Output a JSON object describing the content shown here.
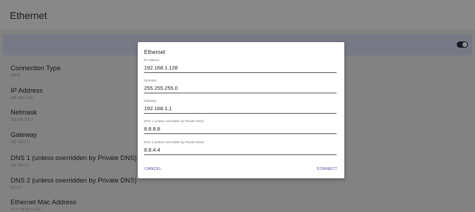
{
  "appbar": {
    "title": "Ethernet"
  },
  "settings": [
    {
      "title": "Connection Type",
      "subtitle": "DHCP"
    },
    {
      "title": "IP Address",
      "subtitle": "192.168.1.116"
    },
    {
      "title": "Netmask",
      "subtitle": "255.255.255.0"
    },
    {
      "title": "Gateway",
      "subtitle": "192.168.1.1"
    },
    {
      "title": "DNS 1 (unless overridden by Private DNS)",
      "subtitle": "192.168.1.1"
    },
    {
      "title": "DNS 2 (unless overridden by Private DNS)",
      "subtitle": "0.0.0.0"
    },
    {
      "title": "Ethernet Mac Address",
      "subtitle": "74:37:38:00:C1:DD"
    }
  ],
  "dialog": {
    "title": "Ethernet",
    "fields": [
      {
        "label": "IP Address",
        "value": "192.168.1.128"
      },
      {
        "label": "Netmask",
        "value": "255.255.255.0"
      },
      {
        "label": "Gateway",
        "value": "192.168.1.1"
      },
      {
        "label": "DNS 1 (unless overridden by Private DNS)",
        "value": "8.8.8.8"
      },
      {
        "label": "DNS 2 (unless overridden by Private DNS)",
        "value": "8.8.4.4"
      }
    ],
    "cancel_label": "CANCEL",
    "connect_label": "CONNECT"
  },
  "colors": {
    "accent": "#3a3f8f",
    "toggle_row": "#d9def5"
  },
  "toggle_on": true
}
